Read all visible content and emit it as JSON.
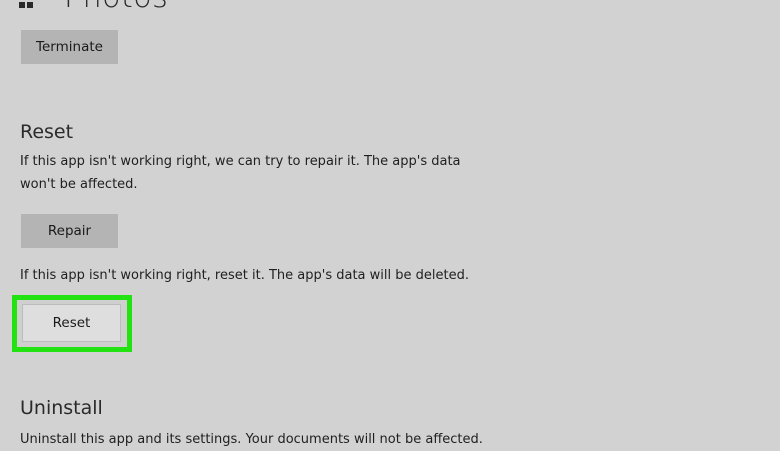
{
  "app": {
    "title": "Photos",
    "icon": "apps-grid-icon"
  },
  "terminate": {
    "button_label": "Terminate"
  },
  "reset_section": {
    "heading": "Reset",
    "repair_description": "If this app isn't working right, we can try to repair it. The app's data won't be affected.",
    "repair_button_label": "Repair",
    "reset_description": "If this app isn't working right, reset it. The app's data will be deleted.",
    "reset_button_label": "Reset"
  },
  "uninstall_section": {
    "heading": "Uninstall",
    "description": "Uninstall this app and its settings. Your documents will not be affected."
  },
  "colors": {
    "background": "#d2d2d2",
    "button": "#b4b4b4",
    "highlight": "#22e311"
  }
}
